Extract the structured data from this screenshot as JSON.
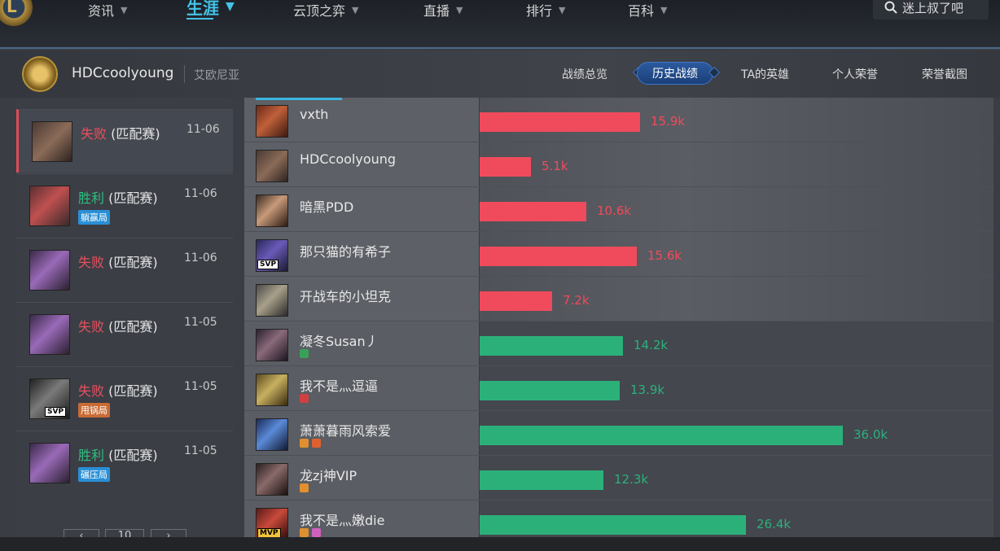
{
  "nav": {
    "items": [
      {
        "label": "资讯"
      },
      {
        "label": "生涯"
      },
      {
        "label": "云顶之弈"
      },
      {
        "label": "直播"
      },
      {
        "label": "排行"
      },
      {
        "label": "百科"
      }
    ],
    "active_index": 1,
    "search_text": "迷上叔了吧"
  },
  "profile": {
    "name": "HDCcoolyoung",
    "server": "艾欧尼亚",
    "tabs": [
      "战绩总览",
      "历史战绩",
      "TA的英雄",
      "个人荣誉",
      "荣誉截图"
    ],
    "active_tab_index": 1
  },
  "matches": [
    {
      "result": "失败",
      "mode": "(匹配赛)",
      "date": "11-06",
      "tag": "",
      "svp": false,
      "selected": true
    },
    {
      "result": "胜利",
      "mode": "(匹配赛)",
      "date": "11-06",
      "tag": "躺赢局",
      "svp": false,
      "selected": false
    },
    {
      "result": "失败",
      "mode": "(匹配赛)",
      "date": "11-06",
      "tag": "",
      "svp": false,
      "selected": false
    },
    {
      "result": "失败",
      "mode": "(匹配赛)",
      "date": "11-05",
      "tag": "",
      "svp": false,
      "selected": false
    },
    {
      "result": "失败",
      "mode": "(匹配赛)",
      "date": "11-05",
      "tag": "甩锅局",
      "svp": true,
      "svp_label": "SVP",
      "selected": false
    },
    {
      "result": "胜利",
      "mode": "(匹配赛)",
      "date": "11-05",
      "tag": "碾压局",
      "svp": false,
      "selected": false
    }
  ],
  "pager": {
    "prev": "‹",
    "page": "10",
    "next": "›"
  },
  "players": [
    {
      "name": "vxth",
      "value": 15.9,
      "value_label": "15.9k",
      "team": "loss",
      "self": false
    },
    {
      "name": "HDCcoolyoung",
      "value": 5.1,
      "value_label": "5.1k",
      "team": "loss",
      "self": true
    },
    {
      "name": "暗黑PDD",
      "value": 10.6,
      "value_label": "10.6k",
      "team": "loss",
      "self": false
    },
    {
      "name": "那只猫的有希子",
      "value": 15.6,
      "value_label": "15.6k",
      "team": "loss",
      "self": true,
      "svp_label": "SVP"
    },
    {
      "name": "开战车的小坦克",
      "value": 7.2,
      "value_label": "7.2k",
      "team": "loss",
      "self": false
    },
    {
      "name": "凝冬Susan丿",
      "value": 14.2,
      "value_label": "14.2k",
      "team": "win",
      "self": false
    },
    {
      "name": "我不是灬逗逼",
      "value": 13.9,
      "value_label": "13.9k",
      "team": "win",
      "self": false
    },
    {
      "name": "萧萧暮雨风索爱",
      "value": 36.0,
      "value_label": "36.0k",
      "team": "win",
      "self": false
    },
    {
      "name": "龙zj神VIP",
      "value": 12.3,
      "value_label": "12.3k",
      "team": "win",
      "self": false
    },
    {
      "name": "我不是灬嫩die",
      "value": 26.4,
      "value_label": "26.4k",
      "team": "win",
      "self": false,
      "svp_label": "MVP"
    }
  ],
  "colors": {
    "loss": "#f04b5c",
    "win": "#2cb07a",
    "accent": "#43c3e8"
  }
}
